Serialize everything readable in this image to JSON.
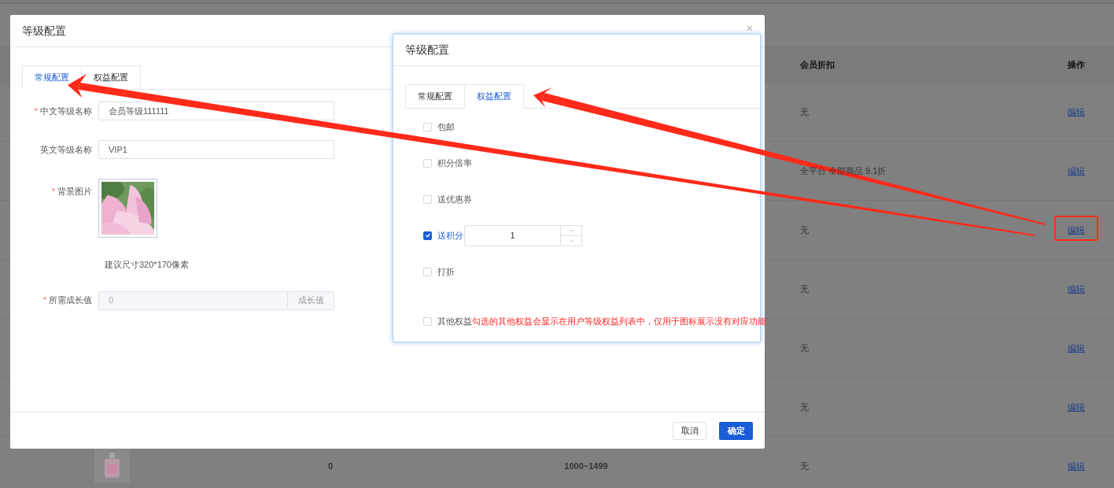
{
  "background_table": {
    "columns": [
      {
        "label": "会员折扣"
      },
      {
        "label": "操作"
      }
    ],
    "rows": [
      {
        "discount": "无",
        "action": "编辑",
        "annotated": false
      },
      {
        "discount": "全平台 全部商品 9.1折",
        "action": "编辑",
        "annotated": false
      },
      {
        "discount": "无",
        "action": "编辑",
        "annotated": true
      },
      {
        "discount": "无",
        "action": "编辑",
        "annotated": false
      },
      {
        "discount": "无",
        "action": "编辑",
        "annotated": false
      },
      {
        "discount": "无",
        "action": "编辑",
        "annotated": false
      },
      {
        "column_2": "0",
        "column_3": "1000~1499",
        "discount": "无",
        "action": "编辑",
        "annotated": false
      }
    ]
  },
  "dialog": {
    "title": "等级配置",
    "close": "×",
    "tabs": [
      {
        "label": "常规配置",
        "selected": true
      },
      {
        "label": "权益配置",
        "selected": false
      }
    ],
    "fields": [
      {
        "kind": "text",
        "label": "中文等级名称",
        "required": true,
        "value": "会员等级111111"
      },
      {
        "kind": "text",
        "label": "英文等级名称",
        "required": false,
        "value": "VIP1"
      },
      {
        "label": "背景图片",
        "required": true
      },
      {
        "kind": "hint",
        "text": "建议尺寸320*170像素"
      },
      {
        "kind": "addon",
        "label": "所需成长值",
        "required": true,
        "placeholder": "0",
        "addon": "成长值",
        "disabled": true
      }
    ],
    "required_mark": "*",
    "buttons": [
      {
        "label": "取消",
        "kind": "default"
      },
      {
        "label": "确定",
        "kind": "primary"
      }
    ]
  },
  "overlay_dialog": {
    "title": "等级配置",
    "tabs": [
      {
        "label": "常规配置",
        "selected": false
      },
      {
        "label": "权益配置",
        "selected": true
      }
    ],
    "benefits": [
      {
        "kind": "plain",
        "label": "包邮",
        "checked": false
      },
      {
        "kind": "plain",
        "label": "积分倍率",
        "checked": false
      },
      {
        "kind": "plain",
        "label": "送优惠券",
        "checked": false
      },
      {
        "kind": "number",
        "label": "送积分",
        "checked": true,
        "value": "1"
      },
      {
        "kind": "plain",
        "label": "打折",
        "checked": false
      },
      {
        "kind": "note",
        "label": "其他权益",
        "checked": false,
        "note": "勾选的其他权益会显示在用户等级权益列表中，仅用于图标展示没有对应功能"
      }
    ]
  }
}
